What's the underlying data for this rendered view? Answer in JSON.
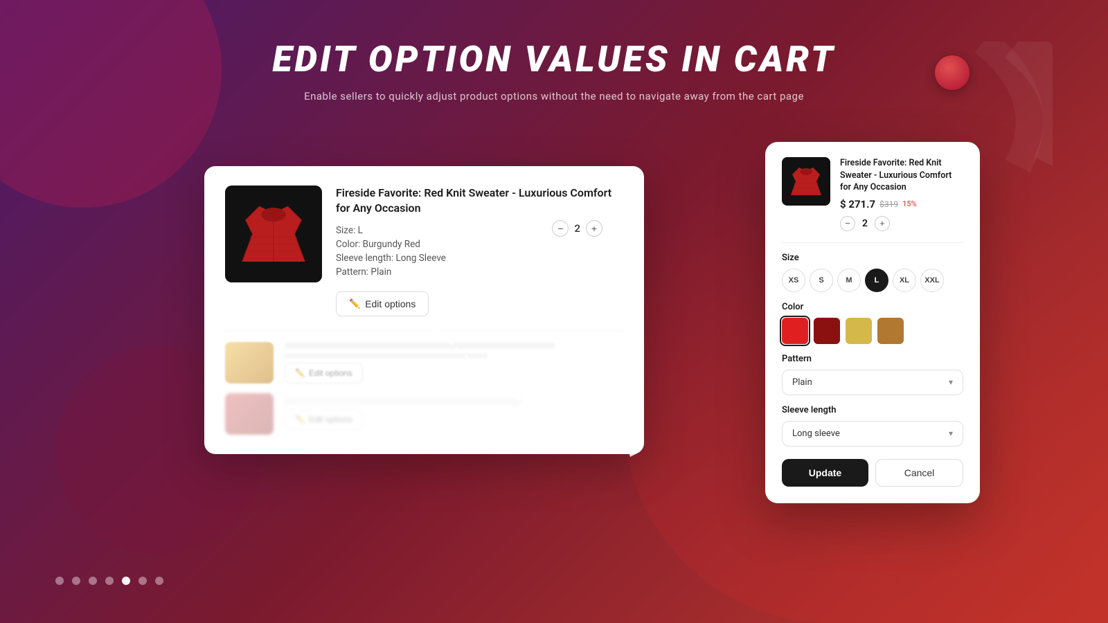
{
  "page": {
    "title": "EDIT OPTION VALUES IN CART",
    "subtitle": "Enable sellers to quickly adjust product options without the need to navigate away from the cart page"
  },
  "cart": {
    "item1": {
      "title": "Fireside Favorite: Red Knit Sweater - Luxurious Comfort for Any Occasion",
      "size_label": "Size: L",
      "color_label": "Color: Burgundy Red",
      "sleeve_label": "Sleeve length: Long Sleeve",
      "pattern_label": "Pattern: Plain",
      "qty": "2",
      "edit_options_label": "Edit options"
    }
  },
  "modal": {
    "product_title": "Fireside Favorite: Red Knit Sweater - Luxurious Comfort for Any Occasion",
    "price_new": "$ 271.7",
    "price_old": "$319",
    "discount": "15%",
    "qty": "2",
    "size_label": "Size",
    "sizes": [
      {
        "label": "XS",
        "active": false
      },
      {
        "label": "S",
        "active": false
      },
      {
        "label": "M",
        "active": false
      },
      {
        "label": "L",
        "active": true
      },
      {
        "label": "XL",
        "active": false
      },
      {
        "label": "XXL",
        "active": false
      }
    ],
    "color_label": "Color",
    "colors": [
      {
        "name": "red",
        "class": "color-red",
        "active": true
      },
      {
        "name": "dark-red",
        "class": "color-dark-red",
        "active": false
      },
      {
        "name": "yellow",
        "class": "color-yellow",
        "active": false
      },
      {
        "name": "brown",
        "class": "color-brown",
        "active": false
      }
    ],
    "pattern_label": "Pattern",
    "pattern_value": "Plain",
    "sleeve_label": "Sleeve length",
    "sleeve_value": "Long sleeve",
    "update_label": "Update",
    "cancel_label": "Cancel"
  },
  "pagination": {
    "total_dots": 7,
    "active_index": 4
  }
}
